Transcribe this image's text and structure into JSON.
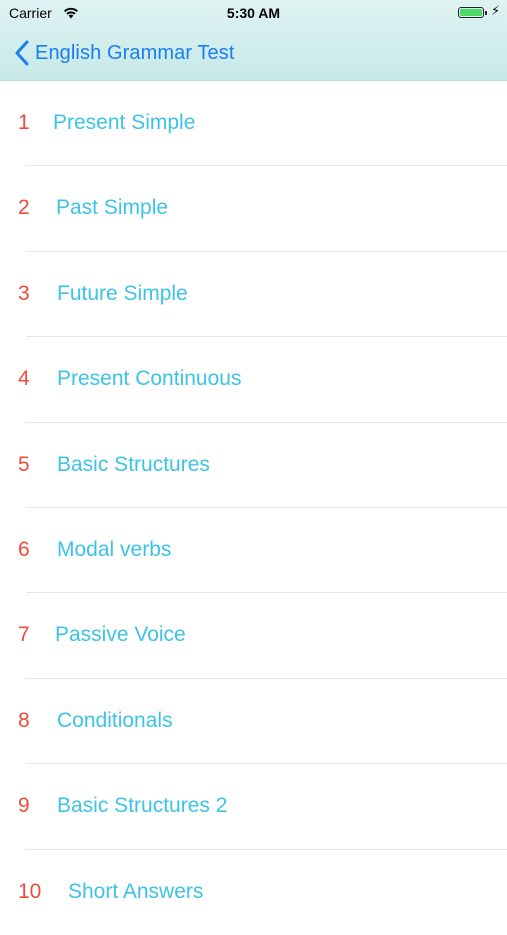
{
  "status_bar": {
    "carrier": "Carrier",
    "time": "5:30 AM",
    "battery_level": 1.0,
    "charging_icon": "lightning-bolt-icon"
  },
  "nav": {
    "back_label": "English Grammar Test"
  },
  "colors": {
    "number": "#f04b3a",
    "title": "#3cc3e6",
    "back": "#1a7df0",
    "nav_background": "#cfeeed"
  },
  "topics": [
    {
      "number": "1",
      "title": "Present Simple"
    },
    {
      "number": "2",
      "title": "Past Simple"
    },
    {
      "number": "3",
      "title": "Future Simple"
    },
    {
      "number": "4",
      "title": "Present Continuous"
    },
    {
      "number": "5",
      "title": "Basic Structures"
    },
    {
      "number": "6",
      "title": "Modal verbs"
    },
    {
      "number": "7",
      "title": "Passive Voice"
    },
    {
      "number": "8",
      "title": "Conditionals"
    },
    {
      "number": "9",
      "title": "Basic Structures 2"
    },
    {
      "number": "10",
      "title": "Short Answers"
    }
  ]
}
